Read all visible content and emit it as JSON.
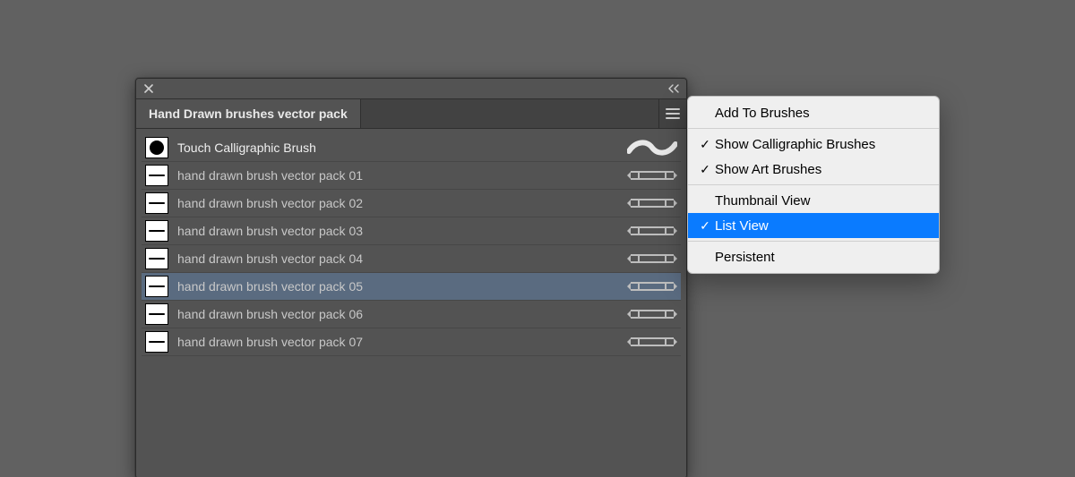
{
  "panel": {
    "title": "Hand Drawn brushes vector pack"
  },
  "brushes": [
    {
      "label": "Touch Calligraphic Brush",
      "thumb": "circle",
      "preview": "wave",
      "selected": false
    },
    {
      "label": "hand drawn brush vector pack 01",
      "thumb": "stroke",
      "preview": "banner",
      "selected": false
    },
    {
      "label": "hand drawn brush vector pack 02",
      "thumb": "stroke",
      "preview": "banner",
      "selected": false
    },
    {
      "label": "hand drawn brush vector pack 03",
      "thumb": "stroke",
      "preview": "banner",
      "selected": false
    },
    {
      "label": "hand drawn brush vector pack 04",
      "thumb": "stroke",
      "preview": "banner",
      "selected": false
    },
    {
      "label": "hand drawn brush vector pack 05",
      "thumb": "stroke",
      "preview": "banner",
      "selected": true
    },
    {
      "label": "hand drawn brush vector pack 06",
      "thumb": "stroke",
      "preview": "banner",
      "selected": false
    },
    {
      "label": "hand drawn brush vector pack 07",
      "thumb": "stroke",
      "preview": "banner",
      "selected": false
    }
  ],
  "menu": {
    "items": [
      {
        "label": "Add To Brushes",
        "checked": false,
        "highlight": false,
        "sep_after": true
      },
      {
        "label": "Show Calligraphic Brushes",
        "checked": true,
        "highlight": false,
        "sep_after": false
      },
      {
        "label": "Show Art Brushes",
        "checked": true,
        "highlight": false,
        "sep_after": true
      },
      {
        "label": "Thumbnail View",
        "checked": false,
        "highlight": false,
        "sep_after": false
      },
      {
        "label": "List View",
        "checked": true,
        "highlight": true,
        "sep_after": true
      },
      {
        "label": "Persistent",
        "checked": false,
        "highlight": false,
        "sep_after": false
      }
    ]
  }
}
